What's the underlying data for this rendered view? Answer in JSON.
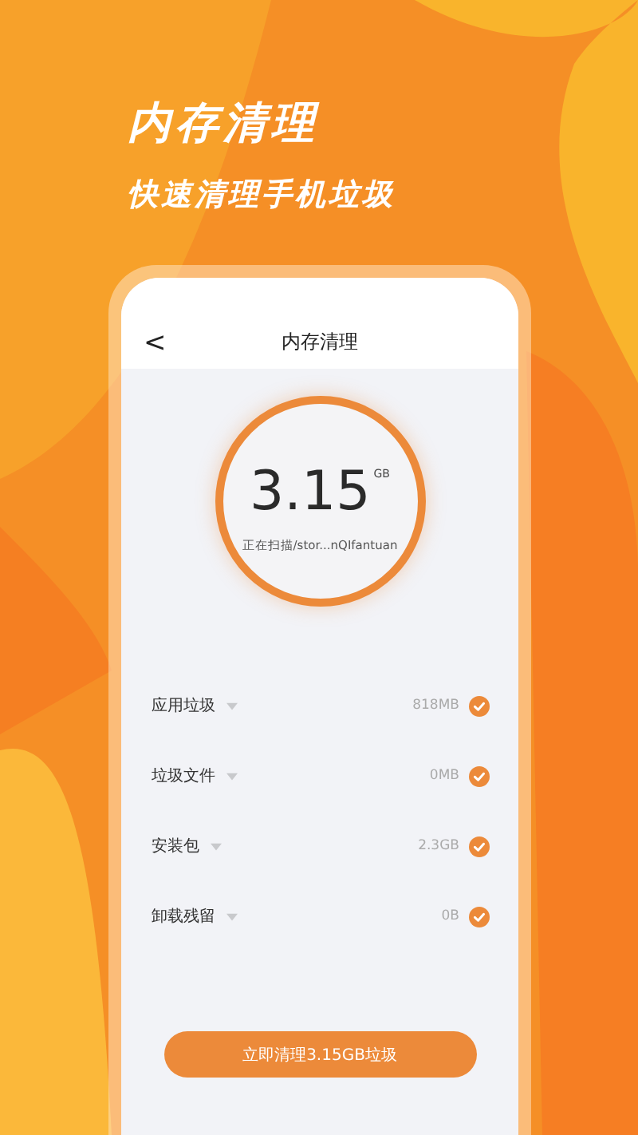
{
  "promo": {
    "headline": "内存清理",
    "subheadline": "快速清理手机垃圾"
  },
  "screen": {
    "title": "内存清理",
    "back": "<",
    "scan": {
      "size": "3.15",
      "unit": "GB",
      "status": "正在扫描/stor...nQIfantuan"
    },
    "items": [
      {
        "label": "应用垃圾",
        "size": "818MB",
        "checked": true
      },
      {
        "label": "垃圾文件",
        "size": "0MB",
        "checked": true
      },
      {
        "label": "安装包",
        "size": "2.3GB",
        "checked": true
      },
      {
        "label": "卸载残留",
        "size": "0B",
        "checked": true
      }
    ],
    "clean_button": "立即清理3.15GB垃圾"
  }
}
